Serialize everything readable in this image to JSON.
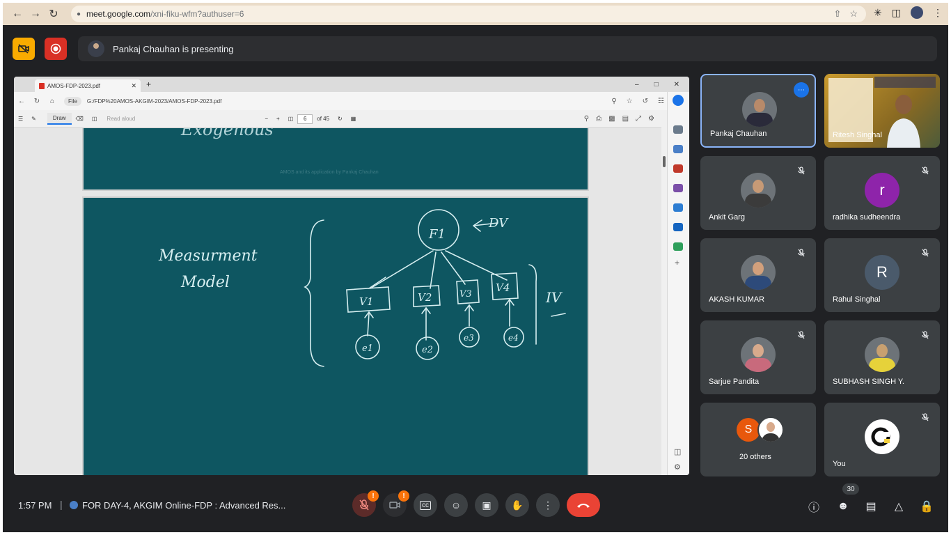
{
  "browser": {
    "url_host": "meet.google.com",
    "url_path": "/xni-fiku-wfm?authuser=6"
  },
  "meet": {
    "presenting_text": "Pankaj Chauhan is presenting",
    "time": "1:57 PM",
    "meeting_title": "FOR DAY-4, AKGIM Online-FDP : Advanced Res...",
    "people_count": "30",
    "mic_badge": "!",
    "cam_badge": "!"
  },
  "shared_screen": {
    "tab_title": "AMOS-FDP-2023.pdf",
    "file_label": "File",
    "file_path": "G:/FDP%20AMOS-AKGIM-2023/AMOS-FDP-2023.pdf",
    "draw_label": "Draw",
    "read_aloud_label": "Read aloud",
    "page_current": "6",
    "page_total": "of 45",
    "footer_text": "AMOS and its application by Pankaj Chauhan",
    "handwriting": {
      "top_fragment": "Exogenous",
      "left_label_1": "Measurment",
      "left_label_2": "Model",
      "factor": "F1",
      "dv": "DV",
      "iv": "IV",
      "vars": [
        "V1",
        "V2",
        "V3",
        "V4"
      ],
      "errors": [
        "e1",
        "e2",
        "e3",
        "e4"
      ]
    }
  },
  "participants": [
    {
      "name": "Pankaj Chauhan",
      "muted": false,
      "avatar_type": "photo"
    },
    {
      "name": "Ritesh Singhal",
      "muted": false,
      "avatar_type": "video"
    },
    {
      "name": "Ankit Garg",
      "muted": true,
      "avatar_type": "photo"
    },
    {
      "name": "radhika sudheendra",
      "muted": true,
      "avatar_type": "letter",
      "letter": "r",
      "color": "#8e24aa"
    },
    {
      "name": "AKASH KUMAR",
      "muted": true,
      "avatar_type": "photo"
    },
    {
      "name": "Rahul Singhal",
      "muted": true,
      "avatar_type": "letter",
      "letter": "R",
      "color": "#4a5a6b"
    },
    {
      "name": "Sarjue Pandita",
      "muted": true,
      "avatar_type": "photo"
    },
    {
      "name": "SUBHASH SINGH Y.",
      "muted": true,
      "avatar_type": "photo"
    },
    {
      "name": "20 others",
      "muted": false,
      "avatar_type": "group",
      "letter": "S"
    },
    {
      "name": "You",
      "muted": true,
      "avatar_type": "logo"
    }
  ],
  "colors": {
    "meet_bg": "#202124",
    "tile_bg": "#3c4043",
    "end_call": "#ea4335",
    "active_speaker": "#8ab4f8",
    "pdf_page": "#0e5661"
  },
  "icons": [
    "camera-off-icon",
    "record-icon",
    "mic-off-icon",
    "video-off-icon",
    "captions-icon",
    "emoji-icon",
    "present-icon",
    "raise-hand-icon",
    "more-options-icon",
    "end-call-icon",
    "info-icon",
    "people-icon",
    "chat-icon",
    "activities-icon",
    "host-controls-icon"
  ]
}
